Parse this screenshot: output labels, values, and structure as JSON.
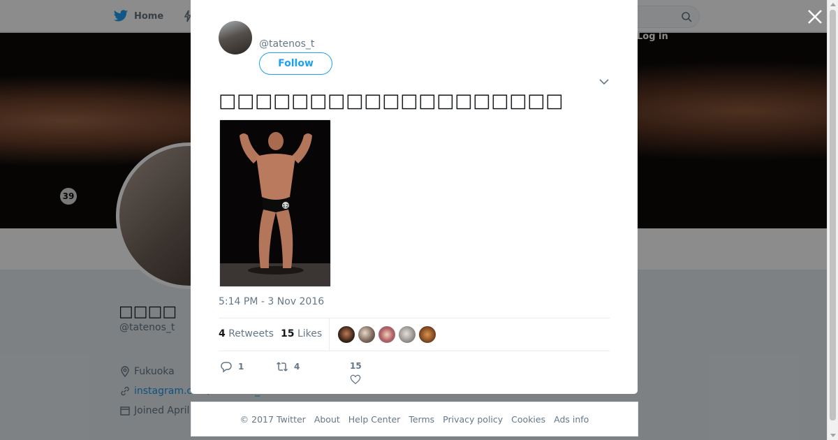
{
  "topnav": {
    "home_label": "Home",
    "login_label": "Log in"
  },
  "profile": {
    "name": "□□□□",
    "handle": "@tatenos_t",
    "location": "Fukuoka",
    "link": "instagram.com/tomohiro_tateno",
    "joined": "Joined April"
  },
  "tweet": {
    "handle": "@tatenos_t",
    "follow_label": "Follow",
    "text": "□□□□□□□□□□□□□□□□□□□",
    "timestamp": "5:14 PM - 3 Nov 2016",
    "retweets_count": "4",
    "retweets_label": "Retweets",
    "likes_count": "15",
    "likes_label": "Likes",
    "reply_count": "1",
    "retweet_count": "4",
    "like_count": "15",
    "photo_badge": "12"
  },
  "cover": {
    "badge": "39"
  },
  "footer": {
    "copyright": "© 2017 Twitter",
    "links": [
      "About",
      "Help Center",
      "Terms",
      "Privacy policy",
      "Cookies",
      "Ads info"
    ]
  },
  "colors": {
    "twitter_blue": "#1da1f2",
    "link_blue": "#1b95e0",
    "text_gray": "#657786"
  }
}
